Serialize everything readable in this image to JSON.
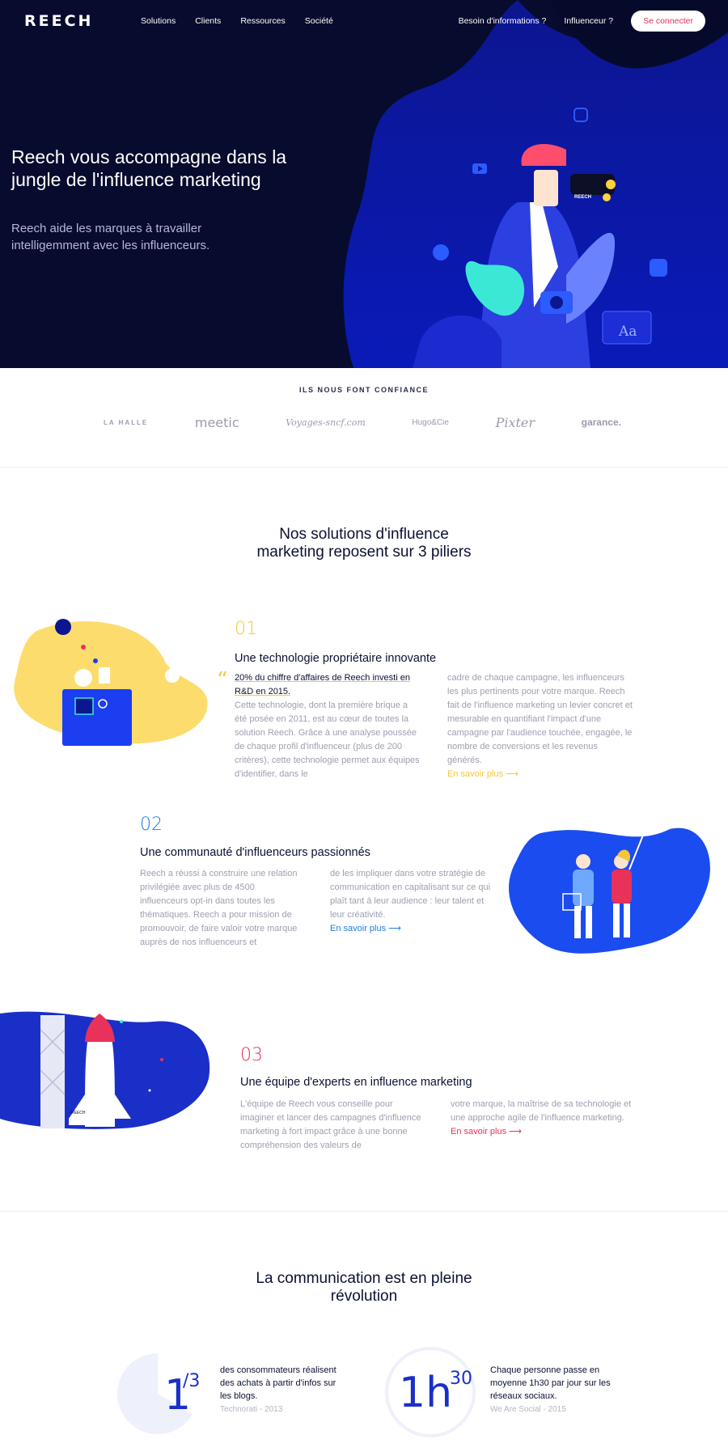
{
  "brand": "REECH",
  "nav": {
    "links": [
      "Solutions",
      "Clients",
      "Ressources",
      "Société"
    ],
    "info_label": "Besoin d'informations ?",
    "influencer_label": "Influenceur ?",
    "connect_label": "Se connecter"
  },
  "hero": {
    "title": "Reech vous accompagne dans la jungle de l'influence marketing",
    "subtitle": "Reech aide les marques à travailler intelligemment avec les influenceurs.",
    "badge_text": "REECH",
    "font_sample": "Aa"
  },
  "trust": {
    "title": "ILS NOUS FONT CONFIANCE",
    "logos": [
      "LA HALLE",
      "meetic",
      "Voyages-sncf.com",
      "Hugo&Cie",
      "Pixter",
      "garance."
    ]
  },
  "solutions": {
    "title_line1": "Nos solutions d'influence",
    "title_line2": "marketing reposent sur 3 piliers",
    "pillars": [
      {
        "num": "01",
        "title": "Une technologie propriétaire innovante",
        "highlight": "20% du chiffre d'affaires de Reech investi en R&D en 2015.",
        "col1": "Cette technologie, dont la première brique a été posée en 2011, est au cœur de toutes la solution Reech. Grâce à une analyse poussée de chaque profil d'influenceur (plus de 200 critères), cette technologie permet aux équipes d'identifier, dans le",
        "col2": "cadre de chaque campagne, les influenceurs les plus pertinents pour votre marque. Reech fait de l'influence marketing un levier concret et mesurable en quantifiant l'impact d'une campagne par l'audience touchée, engagée, le nombre de conversions et les revenus générés.",
        "link": "En savoir plus ⟶",
        "color": "#f5c53b"
      },
      {
        "num": "02",
        "title": "Une communauté d'influenceurs passionnés",
        "col1": "Reech a réussi à construire une relation privilégiée avec plus de 4500 influenceurs opt-in dans toutes les thématiques. Reech a pour mission de promouvoir, de faire valoir votre marque auprès de nos influenceurs et",
        "col2": "de les impliquer dans votre stratégie de communication en capitalisant sur ce qui plaît tant à leur audience : leur talent et leur créativité.",
        "link": "En savoir plus ⟶",
        "color": "#1a7ee6"
      },
      {
        "num": "03",
        "title": "Une équipe d'experts en influence marketing",
        "col1": "L'équipe de Reech vous conseille pour imaginer et lancer des campagnes d'influence marketing à fort impact grâce à une bonne compréhension des valeurs de",
        "col2": "votre marque, la maîtrise de sa technologie et une approche agile de l'influence marketing.",
        "link": "En savoir plus ⟶",
        "color": "#e8325a"
      }
    ],
    "rocket_label": "REECH"
  },
  "stats": {
    "title_line1": "La communication est en pleine",
    "title_line2": "révolution",
    "items": [
      {
        "num_main": "1",
        "num_sup": "/3",
        "text": "des consommateurs réalisent des achats à partir d'infos sur les blogs.",
        "source": "Technorati - 2013"
      },
      {
        "num_main": "1h",
        "num_sup": "30",
        "text": "Chaque personne passe en moyenne 1h30 par jour sur les réseaux sociaux.",
        "source": "We Are Social - 2015"
      }
    ]
  },
  "colors": {
    "navy": "#070b2e",
    "blue": "#1a2fc8",
    "yellow": "#f5c53b",
    "pink": "#e8325a",
    "light_blue": "#1a7ee6"
  }
}
